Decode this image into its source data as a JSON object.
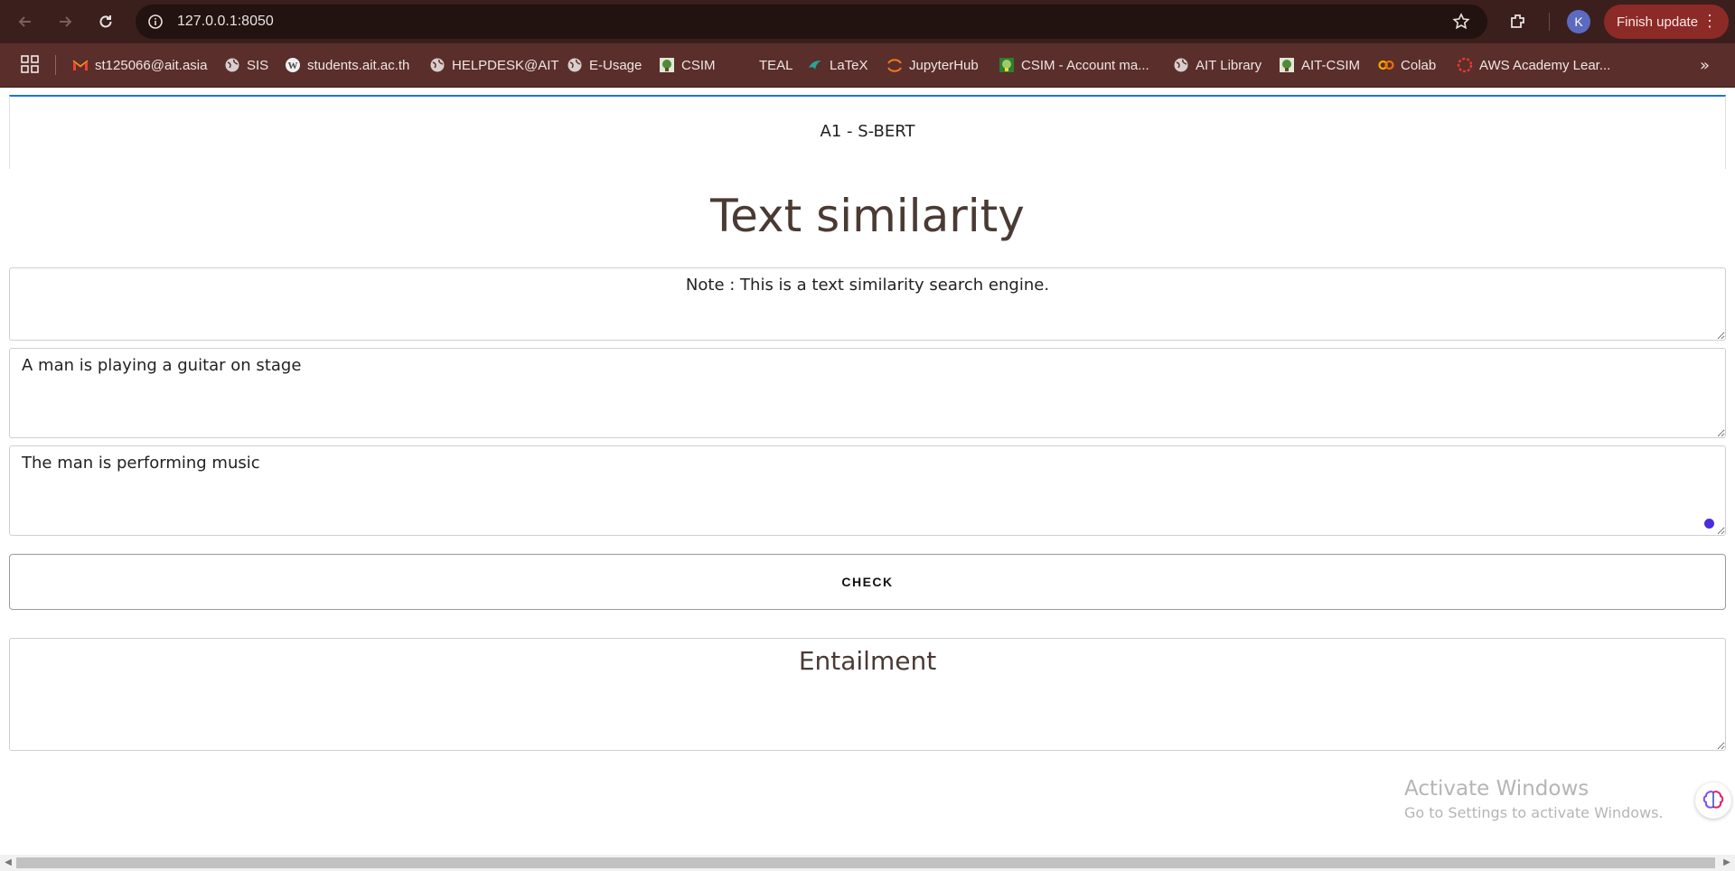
{
  "browser": {
    "url": "127.0.0.1:8050",
    "update_label": "Finish update",
    "profile_initial": "K",
    "bookmarks": [
      {
        "label": "st125066@ait.asia",
        "icon": "gmail-icon"
      },
      {
        "label": "SIS",
        "icon": "globe-icon"
      },
      {
        "label": "students.ait.ac.th",
        "icon": "wordpress-icon"
      },
      {
        "label": "HELPDESK@AIT",
        "icon": "globe-icon"
      },
      {
        "label": "E-Usage",
        "icon": "globe-icon"
      },
      {
        "label": "CSIM",
        "icon": "csim-icon"
      },
      {
        "label": "TEAL",
        "icon": "teal-icon"
      },
      {
        "label": "LaTeX",
        "icon": "latex-icon"
      },
      {
        "label": "JupyterHub",
        "icon": "jupyter-icon"
      },
      {
        "label": "CSIM - Account ma...",
        "icon": "csim-account-icon"
      },
      {
        "label": "AIT Library",
        "icon": "globe-icon"
      },
      {
        "label": "AIT-CSIM",
        "icon": "csim-icon"
      },
      {
        "label": "Colab",
        "icon": "colab-icon"
      },
      {
        "label": "AWS Academy Lear...",
        "icon": "aws-icon"
      }
    ]
  },
  "page": {
    "brand": "A1 - S-BERT",
    "title": "Text similarity",
    "note": "Note : This is a text similarity search engine.",
    "sentence1": "A man is playing a guitar on stage",
    "sentence2": "The man is performing music",
    "check_label": "CHECK",
    "result": "Entailment"
  },
  "os_overlay": {
    "activate_title": "Activate Windows",
    "activate_sub": "Go to Settings to activate Windows."
  },
  "colors": {
    "chrome_top": "#3b1f1c",
    "bookmarks_bar": "#5a2e2a",
    "navbar_accent": "#1a73e8",
    "title_text": "#4a3a34",
    "update_button": "#8c2a27"
  }
}
